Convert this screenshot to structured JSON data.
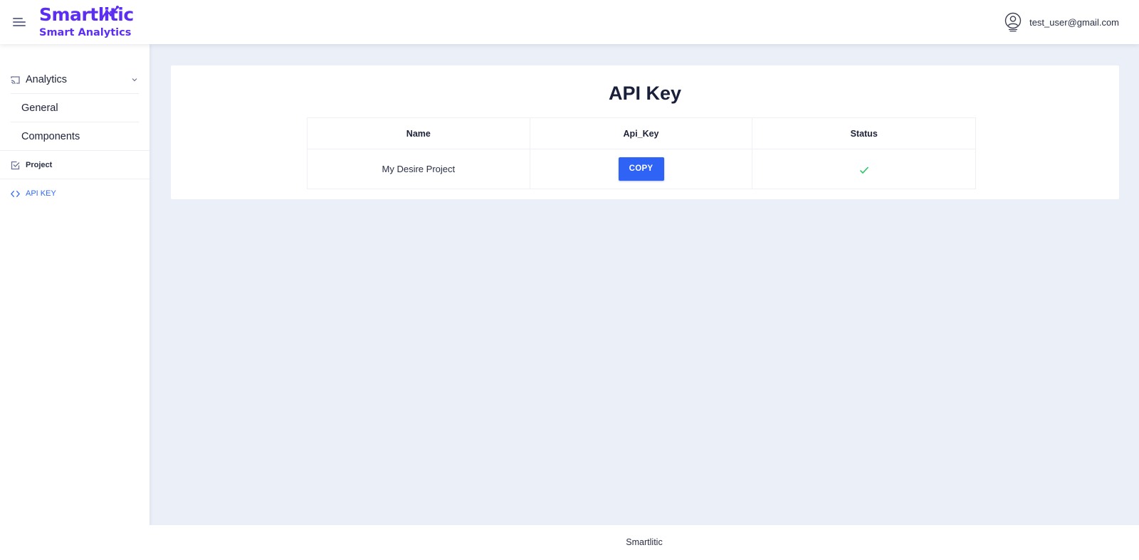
{
  "header": {
    "menu_icon": "hamburger-icon",
    "brand": "Smartlitic",
    "brand_tagline": "Smart Analytics",
    "brand_color": "#5b2ef2",
    "user_icon": "user-circle-icon",
    "user_email": "test_user@gmail.com"
  },
  "sidebar": {
    "analytics": {
      "label": "Analytics",
      "icon": "cast-icon",
      "expand_icon": "chevron-down-icon"
    },
    "analytics_children": [
      {
        "label": "General"
      },
      {
        "label": "Components"
      }
    ],
    "project": {
      "label": "Project",
      "icon": "checkbox-icon"
    },
    "api_key": {
      "label": "API KEY",
      "icon": "code-icon",
      "active_color": "#2e6bf5"
    }
  },
  "main": {
    "title": "API Key",
    "table": {
      "columns": [
        "Name",
        "Api_Key",
        "Status"
      ],
      "rows": [
        {
          "name": "My Desire Project",
          "api_key_button": "COPY",
          "status_icon": "check-icon"
        }
      ]
    }
  },
  "footer": {
    "text": "Smartlitic"
  },
  "colors": {
    "accent": "#2f63f6",
    "success": "#22c55e",
    "background": "#ebeff7"
  }
}
